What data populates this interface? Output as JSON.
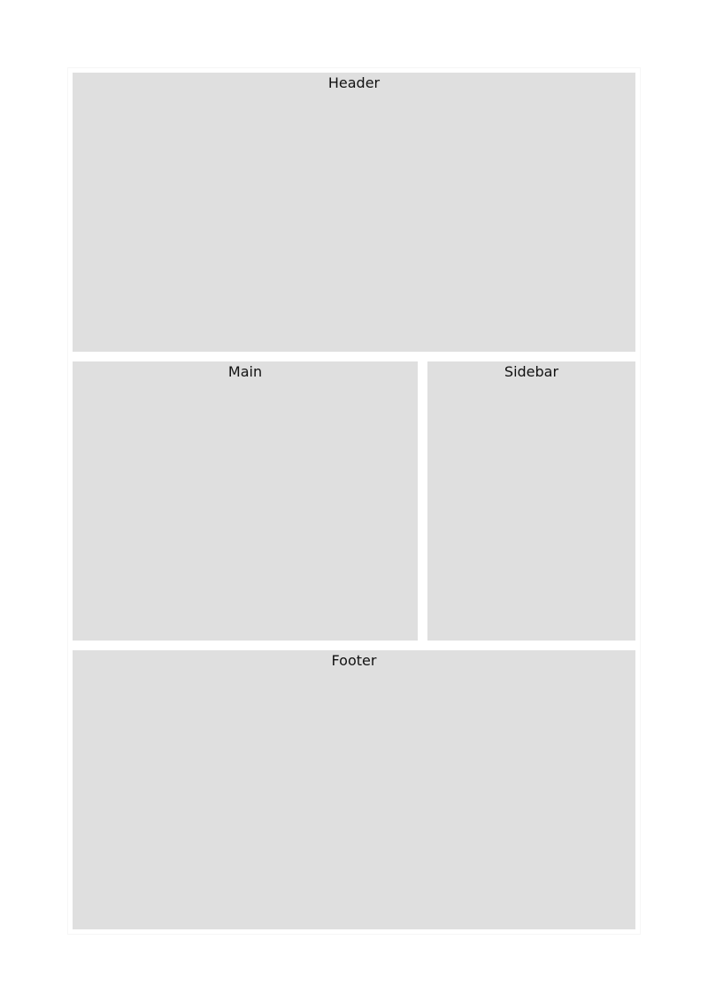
{
  "layout_regions": {
    "header": {
      "label": "Header"
    },
    "main": {
      "label": "Main"
    },
    "sidebar": {
      "label": "Sidebar"
    },
    "footer": {
      "label": "Footer"
    }
  },
  "colors": {
    "page_background": "#ffffff",
    "region_fill": "#dfdfdf",
    "label_text": "#111111"
  }
}
